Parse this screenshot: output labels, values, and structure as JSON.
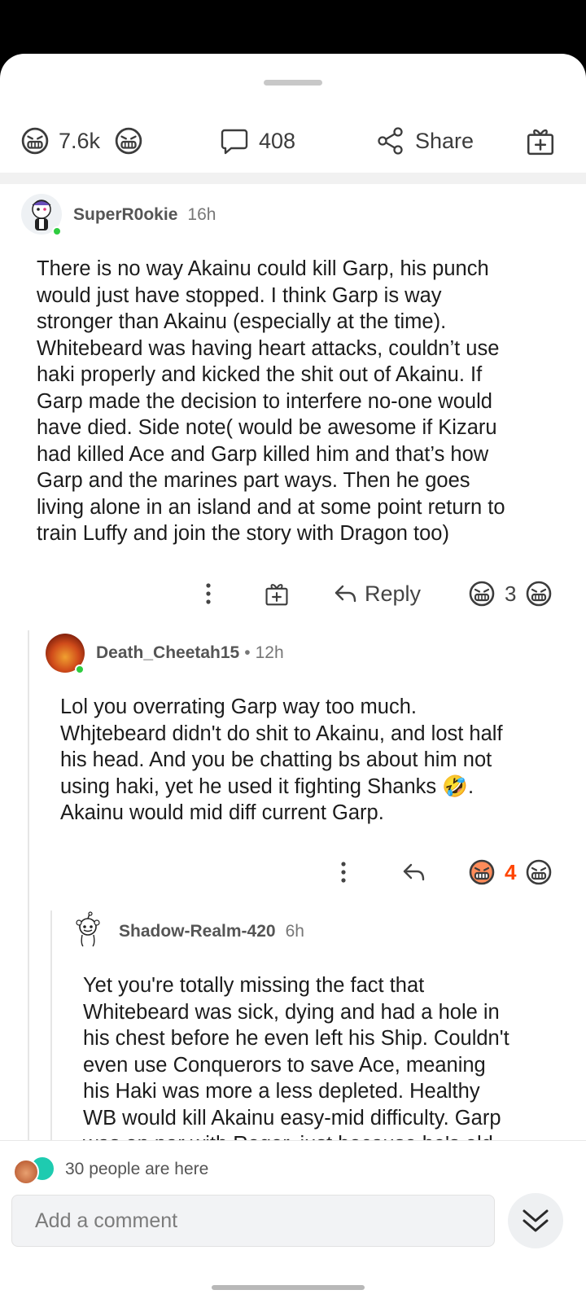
{
  "post_actions": {
    "upvote_count": "7.6k",
    "comment_count": "408",
    "share_label": "Share"
  },
  "comments": [
    {
      "username": "SuperR0okie",
      "separator": "",
      "time": "16h",
      "lines": [
        "There is no way Akainu could kill Garp, his punch",
        "would just have stopped. I think Garp is way",
        "stronger than Akainu (especially at the time).",
        "Whitebeard was having heart attacks, couldn’t use",
        "haki properly and kicked the shit out of Akainu. If",
        "Garp made the decision to interfere no-one would",
        "have died. Side note( would be awesome if Kizaru",
        "had killed Ace and Garp killed him and that’s how",
        "Garp and the marines part ways. Then he goes",
        "living alone in an island and at some point return to",
        "train Luffy and join the story with Dragon too)"
      ],
      "reply_label": "Reply",
      "vote_count": "3"
    },
    {
      "username": "Death_Cheetah15",
      "separator": "•",
      "time": "12h",
      "lines": [
        "Lol you overrating Garp way too much.",
        "Whjtebeard didn't do shit to Akainu, and lost half",
        "his head. And you be chatting bs about him not",
        "using haki, yet he used it fighting Shanks 🤣.",
        "Akainu would mid diff current Garp."
      ],
      "vote_count": "4"
    },
    {
      "username": "Shadow-Realm-420",
      "separator": "",
      "time": "6h",
      "lines": [
        "Yet you're totally missing the fact that",
        "Whitebeard was sick, dying and had a hole in",
        "his chest before he even left his Ship. Couldn't",
        "even use Conquerors to save Ace, meaning",
        "his Haki was more a less depleted. Healthy",
        "WB would kill Akainu easy-mid difficulty. Garp",
        "was on par with Roger, just because he's old"
      ]
    }
  ],
  "bottom": {
    "presence_text": "30 people are here",
    "comment_placeholder": "Add a comment"
  },
  "colors": {
    "accent_orange": "#ff4500",
    "online_green": "#2ecc40",
    "thread_line": "#e6e6e6"
  },
  "icons": [
    "upvote-icon",
    "downvote-icon",
    "comment-bubble-icon",
    "share-icon",
    "award-icon",
    "more-options-icon",
    "reply-arrow-icon",
    "chevron-double-down-icon"
  ]
}
